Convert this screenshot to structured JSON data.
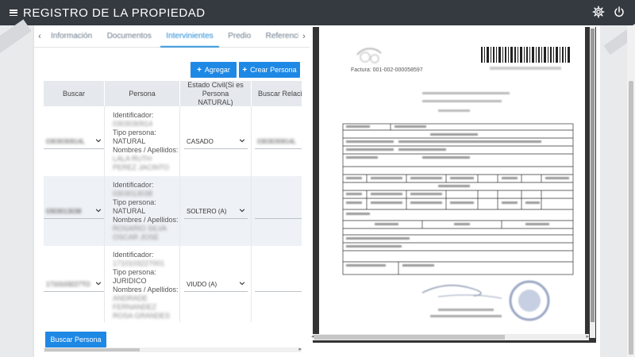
{
  "app": {
    "title": "REGISTRO DE LA PROPIEDAD"
  },
  "icons": {
    "menu": "hamburger-icon",
    "settings": "gear-icon",
    "power": "power-icon"
  },
  "tabs": {
    "items": [
      {
        "label": "Información",
        "active": false
      },
      {
        "label": "Documentos",
        "active": false
      },
      {
        "label": "Intervinientes",
        "active": true
      },
      {
        "label": "Predio",
        "active": false
      },
      {
        "label": "Referencia",
        "active": false
      }
    ]
  },
  "actions": {
    "add_label": "Agregar",
    "create_person_label": "Crear Persona",
    "search_person_label": "Buscar Persona"
  },
  "table": {
    "headers": [
      "Buscar",
      "Persona",
      "Estado Civil(Si es Persona NATURAL)",
      "Buscar Relación"
    ],
    "rows": [
      {
        "buscar": "0303030914L",
        "ident_label": "Identificador:",
        "ident_value": "0303030914",
        "tipo_label": "Tipo persona:",
        "tipo_value": "NATURAL",
        "nombres_label": "Nombres / Apellidos:",
        "nombres_value": "LALA RUTH PEREZ JACINTO",
        "estado": "CASADO",
        "relacion": "0303030914L"
      },
      {
        "buscar": "0303013038",
        "ident_label": "Identificador:",
        "ident_value": "0303013038",
        "tipo_label": "Tipo persona:",
        "tipo_value": "NATURAL",
        "nombres_label": "Nombres / Apellidos:",
        "nombres_value": "ROSARIO SILVA OSCAR JOSE",
        "estado": "SOLTERO (A)",
        "relacion": ""
      },
      {
        "buscar": "1710103227TO",
        "ident_label": "Identificador:",
        "ident_value": "1710103227001",
        "tipo_label": "Tipo persona:",
        "tipo_value": "JURIDICO",
        "nombres_label": "Nombres / Apellidos:",
        "nombres_value": "ANDRADE FERNANDEZ ROSA GRANDES",
        "estado": "VIUDO (A)",
        "relacion": ""
      }
    ]
  },
  "document": {
    "factura_label": "Factura: 001-002-000058597"
  },
  "colors": {
    "topbar": "#343a40",
    "primary": "#1e88e5",
    "tab_active": "#1f8ad6"
  }
}
